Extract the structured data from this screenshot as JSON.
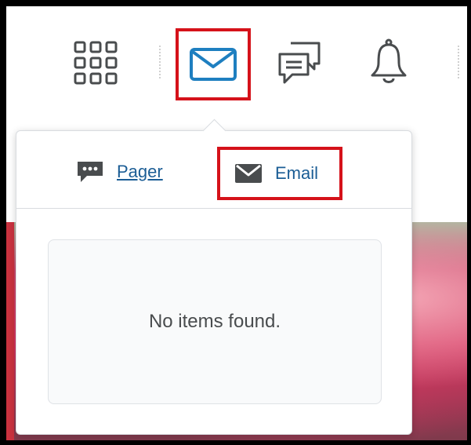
{
  "toolbar": {
    "icons": [
      "waffle-icon",
      "email-icon",
      "message-alerts-icon",
      "bell-icon"
    ],
    "highlight_color": "#d5121a",
    "active_icon_color": "#1e7fc0"
  },
  "popover": {
    "tabs": [
      {
        "label": "Pager",
        "icon": "pager-icon"
      },
      {
        "label": "Email",
        "icon": "envelope-icon"
      }
    ],
    "empty_message": "No items found."
  },
  "colors": {
    "link": "#1b5d95",
    "text": "#494c4e",
    "border": "#d9dce0"
  }
}
